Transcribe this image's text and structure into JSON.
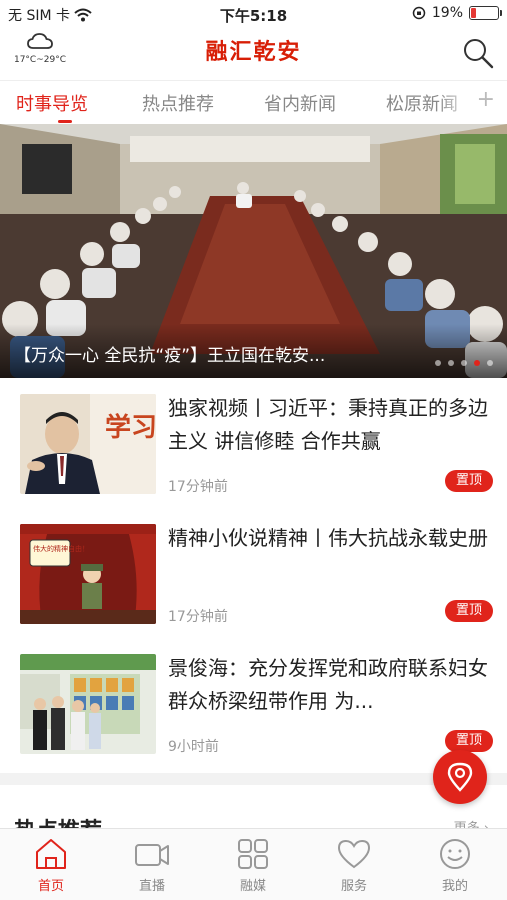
{
  "status_bar": {
    "carrier": "无 SIM 卡",
    "time": "下午5:18",
    "battery": "19%",
    "battery_level": 0.19
  },
  "header": {
    "title": "融汇乾安",
    "weather_temp": "17°C~29°C",
    "weather_icon": "cloud-icon",
    "search_icon": "search-icon"
  },
  "tabs": [
    {
      "label": "时事导览",
      "active": true
    },
    {
      "label": "热点推荐",
      "active": false
    },
    {
      "label": "省内新闻",
      "active": false
    },
    {
      "label": "松原新闻",
      "active": false
    }
  ],
  "tab_add": "+",
  "banner": {
    "caption": "【万众一心 全民抗“疫”】王立国在乾安...",
    "slide_count": 5,
    "active_slide": 4
  },
  "news": [
    {
      "title": "独家视频丨习近平：秉持真正的多边主义 讲信修睦 合作共赢",
      "time": "17分钟前",
      "badge": "置顶",
      "thumb_text": "学习"
    },
    {
      "title": "精神小伙说精神丨伟大抗战永载史册",
      "time": "17分钟前",
      "badge": "置顶",
      "thumb_text": "伟大的精神自由！"
    },
    {
      "title": "景俊海：充分发挥党和政府联系妇女群众桥梁纽带作用 为...",
      "time": "9小时前",
      "badge": "置顶",
      "thumb_text": ""
    }
  ],
  "section": {
    "title": "热点推荐",
    "more": "更多 ›"
  },
  "bottom_nav": [
    {
      "label": "首页",
      "icon": "home-icon",
      "active": true
    },
    {
      "label": "直播",
      "icon": "video-camera-icon",
      "active": false
    },
    {
      "label": "融媒",
      "icon": "grid-icon",
      "active": false
    },
    {
      "label": "服务",
      "icon": "heart-icon",
      "active": false
    },
    {
      "label": "我的",
      "icon": "smiley-face-icon",
      "active": false
    }
  ],
  "colors": {
    "accent": "#e0241b",
    "title_red": "#d81e06"
  }
}
